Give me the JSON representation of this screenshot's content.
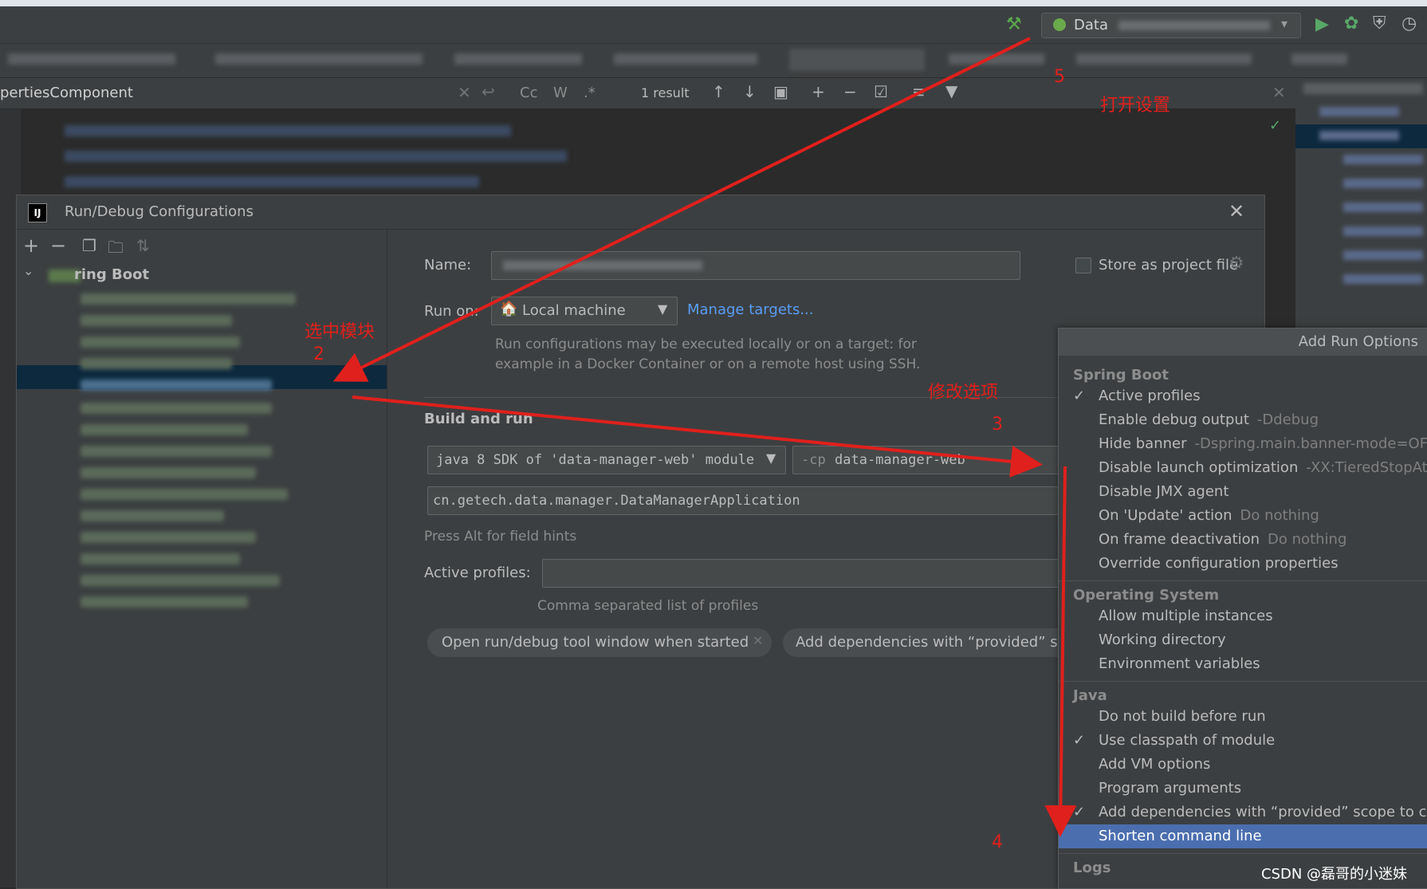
{
  "ide": {
    "run_config_selector": "Data",
    "find_bar": {
      "search_text": "pertiesComponent",
      "result_count": "1 result",
      "case_label": "Cc",
      "word_label": "W",
      "regex_label": ".*"
    }
  },
  "dialog": {
    "title": "Run/Debug Configurations",
    "tree_root_label": "ring Boot",
    "name_label": "Name:",
    "store_as_project_file": "Store as project file",
    "run_on_label": "Run on:",
    "run_on_value": "Local machine",
    "manage_targets": "Manage targets...",
    "run_on_hint_line1": "Run configurations may be executed locally or on a target: for",
    "run_on_hint_line2": "example in a Docker Container or on a remote host using SSH.",
    "build_and_run": "Build and run",
    "sdk_value": "java 8 SDK of 'data-manager-web' module",
    "cp_prefix": "-cp",
    "cp_value": "data-manager-web",
    "main_class": "cn.getech.data.manager.DataManagerApplication",
    "field_hints": "Press Alt for field hints",
    "active_profiles_label": "Active profiles:",
    "active_profiles_hint": "Comma separated list of profiles",
    "chip1": "Open run/debug tool window when started",
    "chip2": "Add dependencies with “provided” scop"
  },
  "popup": {
    "title": "Add Run Options",
    "sections": {
      "spring_boot": "Spring Boot",
      "operating_system": "Operating System",
      "java": "Java",
      "logs": "Logs"
    },
    "items": {
      "active_profiles": "Active profiles",
      "enable_debug": "Enable debug output",
      "enable_debug_sub": "-Ddebug",
      "hide_banner": "Hide banner",
      "hide_banner_sub": "-Dspring.main.banner-mode=OFF",
      "disable_launch": "Disable launch optimization",
      "disable_launch_sub": "-XX:TieredStopAtL",
      "disable_jmx": "Disable JMX agent",
      "on_update": "On 'Update' action",
      "on_update_sub": "Do nothing",
      "on_frame": "On frame deactivation",
      "on_frame_sub": "Do nothing",
      "override_config": "Override configuration properties",
      "allow_multiple": "Allow multiple instances",
      "working_dir": "Working directory",
      "env_vars": "Environment variables",
      "no_build": "Do not build before run",
      "use_classpath": "Use classpath of module",
      "add_vm": "Add VM options",
      "program_args": "Program arguments",
      "add_deps": "Add dependencies with “provided” scope to cl",
      "shorten_cmd": "Shorten command line"
    }
  },
  "annotations": {
    "open_settings": "打开设置",
    "select_module": "选中模块",
    "n2": "2",
    "modify_options": "修改选项",
    "n3": "3",
    "n4": "4",
    "n5": "5"
  },
  "watermark": "CSDN @磊哥的小迷妹",
  "colors": {
    "accent": "#4a88c7",
    "selection": "#0d293e",
    "popup_selection": "#4b6eaf",
    "annotation": "#e0201c",
    "green": "#499c54"
  }
}
